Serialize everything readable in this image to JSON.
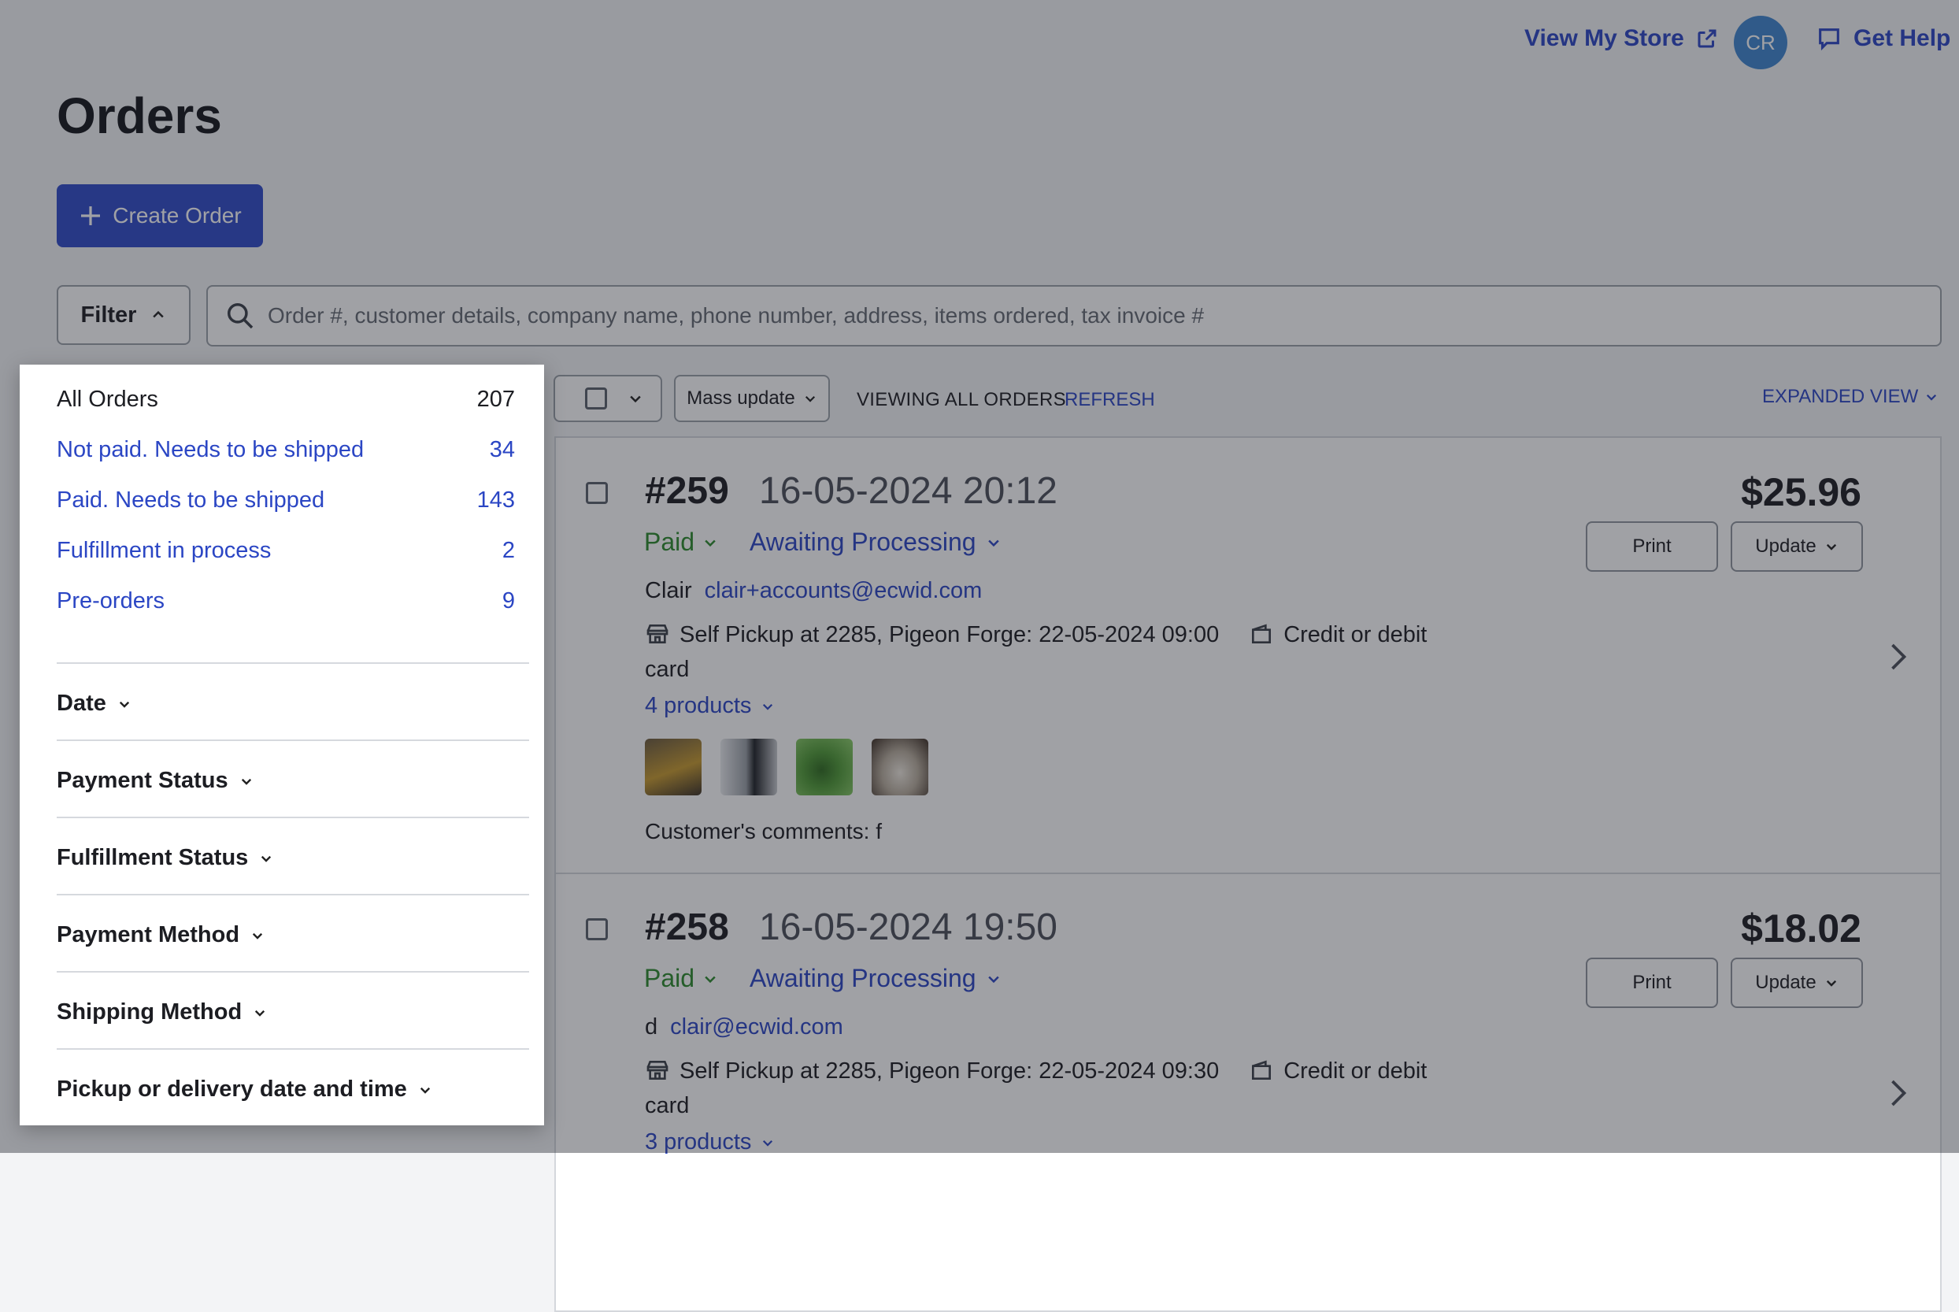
{
  "header": {
    "view_store": "View My Store",
    "avatar_initials": "CR",
    "get_help": "Get Help"
  },
  "page": {
    "title": "Orders",
    "create_order": "Create Order"
  },
  "filter": {
    "button_label": "Filter"
  },
  "search": {
    "placeholder": "Order #, customer details, company name, phone number, address, items ordered, tax invoice #"
  },
  "toolbar": {
    "mass_update": "Mass update",
    "viewing": "VIEWING ALL ORDERS",
    "refresh": "REFRESH",
    "expanded_view": "EXPANDED VIEW"
  },
  "orders": [
    {
      "number": "#259",
      "date": "16-05-2024 20:12",
      "total": "$25.96",
      "print": "Print",
      "update": "Update",
      "payment_status": "Paid",
      "fulfillment_status": "Awaiting Processing",
      "customer_name": "Clair",
      "customer_email": "clair+accounts@ecwid.com",
      "shipping": "Self Pickup at 2285, Pigeon Forge: 22-05-2024 09:00",
      "payment_method": "Credit or debit card",
      "products": "4 products",
      "comment": "Customer's comments: f"
    },
    {
      "number": "#258",
      "date": "16-05-2024 19:50",
      "total": "$18.02",
      "print": "Print",
      "update": "Update",
      "payment_status": "Paid",
      "fulfillment_status": "Awaiting Processing",
      "customer_name": "d",
      "customer_email": "clair@ecwid.com",
      "shipping": "Self Pickup at 2285, Pigeon Forge: 22-05-2024 09:30",
      "payment_method": "Credit or debit card",
      "products": "3 products"
    }
  ],
  "dropdown": {
    "quick_filters": [
      {
        "label": "All Orders",
        "count": "207"
      },
      {
        "label": "Not paid. Needs to be shipped",
        "count": "34"
      },
      {
        "label": "Paid. Needs to be shipped",
        "count": "143"
      },
      {
        "label": "Fulfillment in process",
        "count": "2"
      },
      {
        "label": "Pre-orders",
        "count": "9"
      }
    ],
    "sections": [
      "Date",
      "Payment Status",
      "Fulfillment Status",
      "Payment Method",
      "Shipping Method",
      "Pickup or delivery date and time"
    ]
  },
  "colors": {
    "brand": "#2f4bc9",
    "link": "#2b46c4",
    "paid": "#2c8a2c",
    "avatar": "#3f86cf"
  }
}
